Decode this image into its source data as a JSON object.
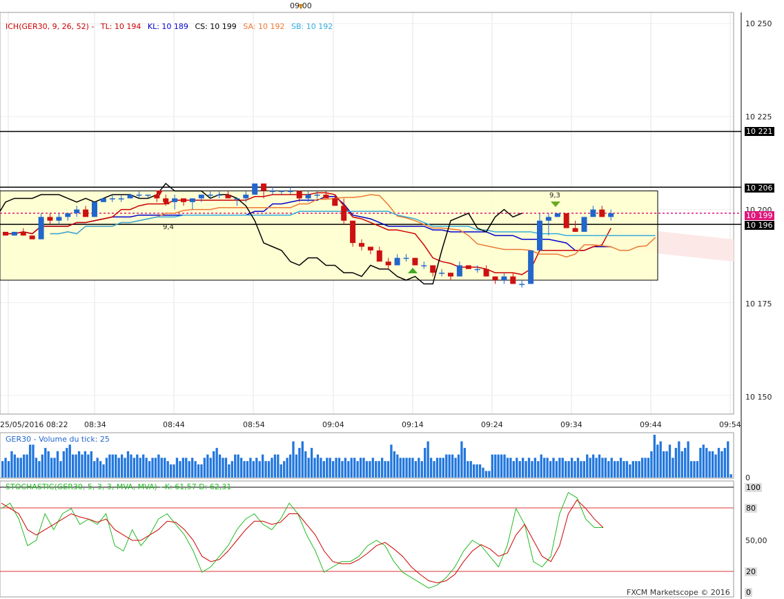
{
  "top_time": "09:00",
  "ichimoku": {
    "name": "ICH(GER30, 9, 26, 52) -",
    "tl": "TL: 10 194",
    "kl": "KL: 10 189",
    "cs": "CS: 10 199",
    "sa": "SA: 10 192",
    "sb": "SB: 10 192"
  },
  "volume_label": "GER30 - Volume du tick: 25",
  "stoch_label": "STOCHASTIC(GER30, 5, 3, 3, MVA, MVA) -   K: 61,57    D: 62,31",
  "y_ticks": [
    "10 250",
    "10 225",
    "10 200",
    "10 175",
    "10 150"
  ],
  "price_tags": {
    "a": "10 221",
    "b": "10 206",
    "c": "10 199",
    "d": "10 196"
  },
  "annotations": {
    "low_label": "9,4",
    "high_label": "9,3"
  },
  "x_ticks": [
    "25/05/2016 08:22",
    "08:34",
    "08:44",
    "08:54",
    "09:04",
    "09:14",
    "09:24",
    "09:34",
    "09:44",
    "09:54"
  ],
  "vol_zero": "0",
  "stoch_ticks": {
    "t100": "100",
    "t80": "80",
    "t50": "50,00",
    "t20": "20",
    "t0": "0"
  },
  "copyright": "FXCM Marketscope © 2016",
  "colors": {
    "tenkan": "#cc0000",
    "kijun": "#0000cc",
    "chikou": "#000000",
    "senkou_a": "#ee7733",
    "senkou_b": "#33aadd",
    "up": "#2266cc",
    "down": "#cc1111",
    "box": "#ffffcc",
    "stoch_k": "#22bb22",
    "stoch_d": "#cc0000"
  },
  "chart_data": {
    "type": "candlestick",
    "price_range": [
      10145,
      10253
    ],
    "horizontal_levels": [
      10221,
      10206,
      10199,
      10196
    ],
    "candles": [
      [
        10194,
        10194,
        10193,
        10193
      ],
      [
        10193,
        10194,
        10193,
        10194
      ],
      [
        10194,
        10195,
        10193,
        10193
      ],
      [
        10193,
        10193,
        10192,
        10192
      ],
      [
        10192,
        10199,
        10192,
        10198
      ],
      [
        10198,
        10199,
        10196,
        10197
      ],
      [
        10197,
        10199,
        10196,
        10198
      ],
      [
        10198,
        10199,
        10197,
        10199
      ],
      [
        10199,
        10201,
        10198,
        10200
      ],
      [
        10200,
        10201,
        10198,
        10198
      ],
      [
        10198,
        10202,
        10198,
        10202
      ],
      [
        10202,
        10203,
        10202,
        10203
      ],
      [
        10203,
        10204,
        10202,
        10203
      ],
      [
        10203,
        10204,
        10202,
        10203
      ],
      [
        10203,
        10204,
        10203,
        10204
      ],
      [
        10204,
        10205,
        10203,
        10204
      ],
      [
        10204,
        10204,
        10203,
        10204
      ],
      [
        10204,
        10205,
        10202,
        10203
      ],
      [
        10203,
        10204,
        10201,
        10202
      ],
      [
        10202,
        10204,
        10200,
        10203
      ],
      [
        10203,
        10203,
        10201,
        10202
      ],
      [
        10202,
        10203,
        10200,
        10203
      ],
      [
        10203,
        10204,
        10202,
        10204
      ],
      [
        10204,
        10205,
        10203,
        10204
      ],
      [
        10204,
        10205,
        10203,
        10204
      ],
      [
        10204,
        10205,
        10203,
        10203
      ],
      [
        10203,
        10203,
        10201,
        10203
      ],
      [
        10203,
        10205,
        10202,
        10204
      ],
      [
        10204,
        10207,
        10204,
        10207
      ],
      [
        10207,
        10207,
        10203,
        10205
      ],
      [
        10205,
        10206,
        10204,
        10205
      ],
      [
        10205,
        10205,
        10204,
        10205
      ],
      [
        10205,
        10206,
        10204,
        10205
      ],
      [
        10205,
        10205,
        10202,
        10203
      ],
      [
        10203,
        10205,
        10202,
        10204
      ],
      [
        10204,
        10205,
        10203,
        10204
      ],
      [
        10204,
        10205,
        10203,
        10203
      ],
      [
        10203,
        10204,
        10201,
        10201
      ],
      [
        10201,
        10203,
        10196,
        10197
      ],
      [
        10197,
        10197,
        10190,
        10191
      ],
      [
        10191,
        10192,
        10189,
        10190
      ],
      [
        10190,
        10190,
        10188,
        10189
      ],
      [
        10189,
        10190,
        10186,
        10186
      ],
      [
        10186,
        10187,
        10184,
        10185
      ],
      [
        10185,
        10188,
        10185,
        10187
      ],
      [
        10187,
        10188,
        10186,
        10187
      ],
      [
        10187,
        10187,
        10185,
        10185
      ],
      [
        10185,
        10186,
        10184,
        10185
      ],
      [
        10185,
        10185,
        10182,
        10183
      ],
      [
        10183,
        10184,
        10182,
        10183
      ],
      [
        10183,
        10183,
        10181,
        10182
      ],
      [
        10182,
        10186,
        10182,
        10185
      ],
      [
        10185,
        10185,
        10184,
        10184
      ],
      [
        10184,
        10185,
        10183,
        10184
      ],
      [
        10184,
        10185,
        10182,
        10182
      ],
      [
        10182,
        10182,
        10180,
        10181
      ],
      [
        10181,
        10183,
        10180,
        10182
      ],
      [
        10182,
        10183,
        10180,
        10180
      ],
      [
        10180,
        10181,
        10179,
        10180
      ],
      [
        10180,
        10189,
        10180,
        10189
      ],
      [
        10189,
        10199,
        10189,
        10197
      ],
      [
        10197,
        10199,
        10193,
        10198
      ],
      [
        10198,
        10199,
        10198,
        10199
      ],
      [
        10199,
        10199,
        10195,
        10195
      ],
      [
        10195,
        10197,
        10194,
        10194
      ],
      [
        10194,
        10198,
        10194,
        10198
      ],
      [
        10198,
        10201,
        10198,
        10200
      ],
      [
        10200,
        10201,
        10198,
        10198
      ],
      [
        10198,
        10200,
        10197,
        10199
      ]
    ],
    "ichimoku_current": {
      "tl": 10194,
      "kl": 10189,
      "cs": 10199,
      "sa": 10192,
      "sb": 10192
    },
    "volume": [
      5,
      6,
      5,
      8,
      7,
      6,
      6,
      7,
      7,
      10,
      10,
      6,
      5,
      7,
      9,
      8,
      6,
      6,
      8,
      5,
      8,
      9,
      10,
      7,
      7,
      8,
      7,
      8,
      7,
      8,
      5,
      6,
      5,
      4,
      6,
      7,
      7,
      7,
      6,
      7,
      6,
      8,
      7,
      6,
      7,
      6,
      7,
      6,
      5,
      6,
      6,
      7,
      6,
      6,
      5,
      4,
      4,
      6,
      5,
      6,
      6,
      5,
      6,
      5,
      4,
      4,
      6,
      7,
      6,
      8,
      9,
      7,
      6,
      6,
      4,
      5,
      7,
      7,
      6,
      5,
      5,
      6,
      5,
      6,
      5,
      7,
      5,
      5,
      6,
      7,
      7,
      4,
      5,
      6,
      7,
      11,
      7,
      9,
      11,
      8,
      6,
      9,
      6,
      7,
      6,
      5,
      6,
      6,
      5,
      6,
      6,
      5,
      6,
      5,
      6,
      6,
      5,
      6,
      6,
      5,
      5,
      6,
      5,
      5,
      6,
      5,
      5,
      10,
      8,
      7,
      6,
      6,
      6,
      6,
      6,
      5,
      6,
      5,
      9,
      11,
      6,
      5,
      6,
      6,
      6,
      7,
      7,
      7,
      6,
      7,
      11,
      9,
      5,
      5,
      4,
      4,
      4,
      3,
      2,
      2,
      7,
      7,
      7,
      7,
      7,
      6,
      6,
      5,
      6,
      5,
      6,
      5,
      6,
      5,
      6,
      5,
      7,
      6,
      6,
      5,
      6,
      5,
      6,
      6,
      5,
      5,
      6,
      5,
      6,
      5,
      5,
      7,
      6,
      7,
      6,
      7,
      6,
      6,
      5,
      6,
      5,
      5,
      6,
      5,
      5,
      4,
      5,
      5,
      5,
      6,
      6,
      6,
      8,
      13,
      10,
      11,
      8,
      8,
      10,
      6,
      9,
      11,
      8,
      9,
      11,
      5,
      5,
      5,
      9,
      10,
      9,
      8,
      8,
      7,
      9,
      8,
      9,
      11,
      1
    ],
    "stochastic": {
      "k": [
        80,
        85,
        70,
        45,
        50,
        75,
        60,
        75,
        80,
        65,
        70,
        65,
        75,
        45,
        40,
        60,
        45,
        55,
        70,
        75,
        65,
        55,
        40,
        20,
        25,
        35,
        45,
        60,
        70,
        75,
        65,
        60,
        70,
        85,
        75,
        55,
        40,
        20,
        25,
        30,
        30,
        35,
        45,
        50,
        45,
        30,
        20,
        15,
        10,
        5,
        8,
        15,
        25,
        40,
        50,
        45,
        35,
        25,
        45,
        80,
        65,
        30,
        25,
        35,
        75,
        95,
        90,
        70,
        62,
        62
      ],
      "d": [
        85,
        80,
        75,
        60,
        55,
        60,
        65,
        70,
        75,
        72,
        70,
        67,
        70,
        60,
        55,
        50,
        50,
        55,
        60,
        68,
        67,
        60,
        50,
        35,
        30,
        32,
        40,
        50,
        60,
        68,
        68,
        65,
        67,
        75,
        75,
        65,
        55,
        40,
        30,
        28,
        28,
        32,
        38,
        45,
        48,
        42,
        35,
        25,
        18,
        12,
        10,
        12,
        18,
        30,
        40,
        46,
        42,
        35,
        38,
        55,
        65,
        50,
        35,
        30,
        45,
        75,
        88,
        80,
        70,
        62
      ]
    }
  }
}
